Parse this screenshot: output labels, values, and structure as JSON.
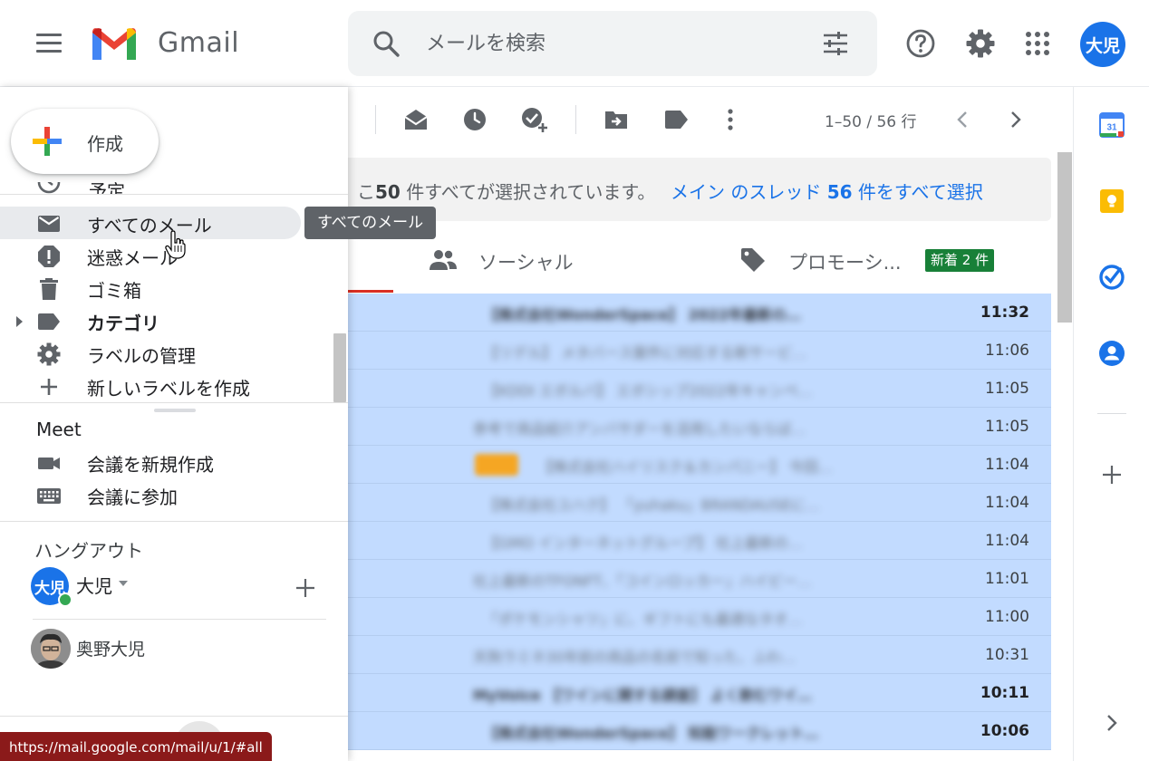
{
  "app": {
    "logo_text": "Gmail",
    "avatar_initials": "大児",
    "accent_color": "#1a73e8"
  },
  "search": {
    "placeholder": "メールを検索"
  },
  "header_icons": [
    "menu-icon",
    "search-icon",
    "tune-icon",
    "help-icon",
    "settings-icon",
    "apps-icon"
  ],
  "compose": {
    "label": "作成"
  },
  "sidebar": {
    "partial_label": "予定",
    "items": [
      {
        "label": "すべてのメール",
        "icon": "mail-icon",
        "active": true
      },
      {
        "label": "迷惑メール",
        "icon": "spam-icon",
        "active": false
      },
      {
        "label": "ゴミ箱",
        "icon": "trash-icon",
        "active": false
      },
      {
        "label": "カテゴリ",
        "icon": "label-icon",
        "active": false
      },
      {
        "label": "ラベルの管理",
        "icon": "gear-icon",
        "active": false
      },
      {
        "label": "新しいラベルを作成",
        "icon": "plus-icon",
        "active": false
      }
    ]
  },
  "tooltip": {
    "text": "すべてのメール"
  },
  "meet": {
    "title": "Meet",
    "items": [
      {
        "label": "会議を新規作成",
        "icon": "videocam-icon"
      },
      {
        "label": "会議に参加",
        "icon": "keyboard-icon"
      }
    ]
  },
  "hangouts": {
    "title": "ハングアウト",
    "user_initials": "大児",
    "user_name": "大児",
    "contacts": [
      {
        "name": "奥野大児"
      }
    ]
  },
  "status_bar": {
    "url": "https://mail.google.com/mail/u/1/#all"
  },
  "toolbar": {
    "icons": [
      "mark-read-icon",
      "snooze-icon",
      "add-task-icon",
      "move-to-icon",
      "label-icon",
      "more-vert-icon"
    ],
    "pagination": "1–50 / 56 行"
  },
  "banner": {
    "text_prefix": "こ",
    "count_bold": "50",
    "text_suffix": " 件すべてが選択されています。",
    "link_text": "メイン のスレッド ",
    "link_count_bold": "56",
    "link_suffix": " 件をすべて選択"
  },
  "tabs": [
    {
      "label": "ソーシャル",
      "icon": "people-icon"
    },
    {
      "label": "プロモーシ...",
      "icon": "tag-icon",
      "badge": "新着 2 件",
      "badge_color": "#188038"
    }
  ],
  "emails": [
    {
      "preview": "【株式会社WonderSpace】 2022年最新の…",
      "time": "11:32",
      "unread": true,
      "chip": false,
      "indent": false
    },
    {
      "preview": "【リデル】 メタバース案件に対応する新サービ…",
      "time": "11:06",
      "unread": false,
      "chip": false,
      "indent": false
    },
    {
      "preview": "【KDDI エボルバ】 エボシップ2022年キャンペ…",
      "time": "11:05",
      "unread": false,
      "chip": false,
      "indent": false
    },
    {
      "preview": "参考で商品紹介アンバサダーを活用したいならば…",
      "time": "11:05",
      "unread": false,
      "chip": false,
      "indent": true
    },
    {
      "preview": "【株式会社ハイリスク＆カンパニー】 今回…",
      "time": "11:04",
      "unread": false,
      "chip": true,
      "indent": false
    },
    {
      "preview": "【株式会社ユハク】 「yuhaku」BRANDAUSEに…",
      "time": "11:04",
      "unread": false,
      "chip": false,
      "indent": false
    },
    {
      "preview": "【GMO インターネットグループ】 社上最新の…",
      "time": "11:04",
      "unread": false,
      "chip": false,
      "indent": false
    },
    {
      "preview": "社上最新のTFONFT、「コインロッカー」ハイビー…",
      "time": "11:01",
      "unread": false,
      "chip": false,
      "indent": true
    },
    {
      "preview": "「ポケモンシャツ」に、ギフトにも最適なタオ…",
      "time": "11:00",
      "unread": false,
      "chip": false,
      "indent": false
    },
    {
      "preview": "天狗ラミネ30年前の商品の名前で知った、ふわ…",
      "time": "10:31",
      "unread": false,
      "chip": false,
      "indent": true
    },
    {
      "preview": "MyVoice 【ワインに関する調査】 よく飲むワイ…",
      "time": "10:11",
      "unread": true,
      "chip": false,
      "indent": true
    },
    {
      "preview": "【株式会社WonderSpace】 知能ワークレット…",
      "time": "10:06",
      "unread": true,
      "chip": false,
      "indent": false
    }
  ],
  "right_panel": {
    "icons": [
      "calendar-icon",
      "keep-icon",
      "tasks-icon",
      "contacts-icon",
      "add-icon",
      "expand-icon"
    ],
    "calendar_day": "31",
    "colors": {
      "calendar": "#4285f4",
      "keep": "#fbbc04",
      "tasks": "#1a73e8",
      "contacts": "#1a73e8"
    }
  }
}
